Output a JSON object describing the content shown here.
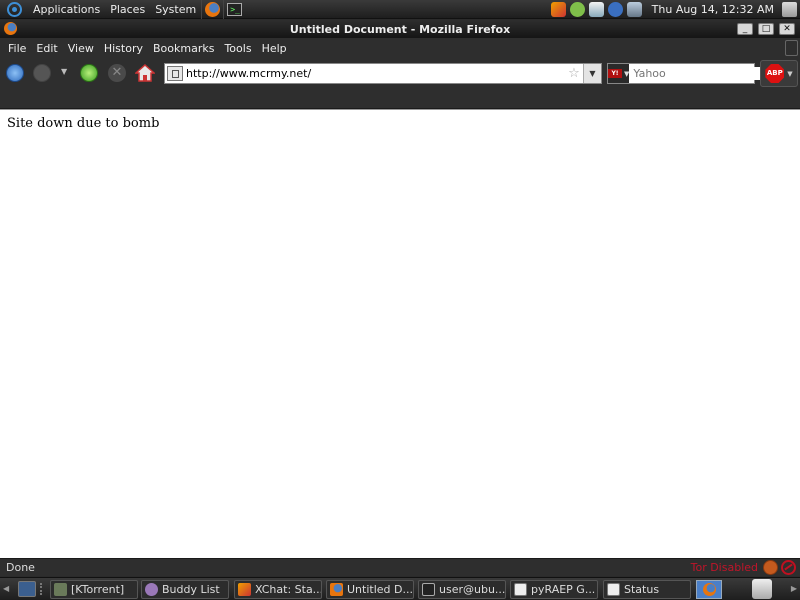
{
  "top_panel": {
    "menus": [
      "Applications",
      "Places",
      "System"
    ],
    "clock": "Thu Aug 14, 12:32 AM",
    "tray_icon_names": [
      "xchat-icon",
      "pidgin-icon",
      "network-icon",
      "bluetooth-icon",
      "monitor-icon"
    ]
  },
  "window": {
    "title": "Untitled Document - Mozilla Firefox",
    "controls": {
      "minimize": "_",
      "maximize": "□",
      "close": "✕"
    }
  },
  "menubar": {
    "items": [
      {
        "label": "File",
        "key": "F"
      },
      {
        "label": "Edit",
        "key": "E"
      },
      {
        "label": "View",
        "key": "V"
      },
      {
        "label": "History",
        "key": "s"
      },
      {
        "label": "Bookmarks",
        "key": "B"
      },
      {
        "label": "Tools",
        "key": "T"
      },
      {
        "label": "Help",
        "key": "H"
      }
    ]
  },
  "navbar": {
    "url": "http://www.mcrmy.net/",
    "search_engine": "Yahoo",
    "search_placeholder": "Yahoo",
    "engine_logo_text": "Y!",
    "abp_label": "ABP"
  },
  "content": {
    "text": "Site down due to bomb"
  },
  "statusbar": {
    "status": "Done",
    "torbutton": "Tor Disabled"
  },
  "taskbar": {
    "tasks": [
      {
        "label": "[KTorrent]",
        "icon": "ktorrent-icon"
      },
      {
        "label": "Buddy List",
        "icon": "pidgin-icon"
      },
      {
        "label": "XChat: Sta...",
        "icon": "xchat-icon"
      },
      {
        "label": "Untitled D...",
        "icon": "firefox-icon"
      },
      {
        "label": "user@ubu...",
        "icon": "terminal-icon"
      },
      {
        "label": "pyRAEP G...",
        "icon": "window-icon"
      },
      {
        "label": "Status",
        "icon": "window-icon"
      }
    ]
  },
  "colors": {
    "panel_bg": "#2e2e2e",
    "torbutton_red": "#c0152a",
    "page_bg": "#ffffff"
  }
}
